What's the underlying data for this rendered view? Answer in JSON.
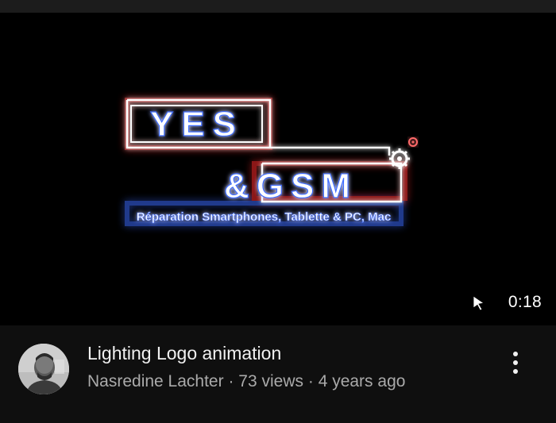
{
  "video": {
    "logo": {
      "line1": "YES",
      "line2": "&GSM",
      "tagline": "Réparation Smartphones, Tablette & PC, Mac"
    },
    "duration": "0:18",
    "cursor_icon": "pointer-cursor-icon"
  },
  "details": {
    "title": "Lighting Logo animation",
    "channel": "Nasredine Lachter",
    "separator": "·",
    "views": "73 views",
    "age": "4 years ago",
    "more_icon": "more-vert-icon"
  },
  "colors": {
    "background": "#0f0f0f",
    "text_primary": "#f1f1f1",
    "text_secondary": "#aaaaaa",
    "glow_red": "#ff2a2a",
    "glow_blue": "#3b6bff"
  }
}
